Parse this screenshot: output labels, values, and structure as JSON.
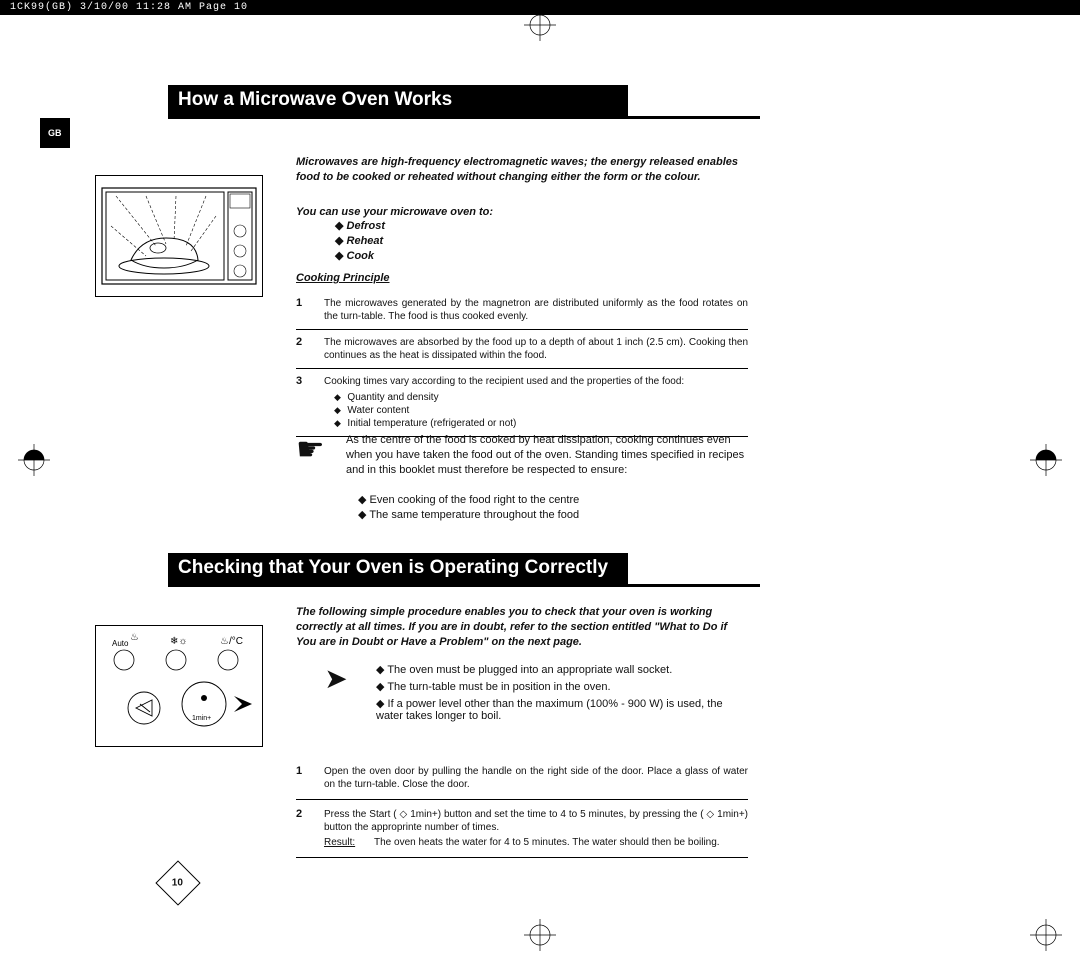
{
  "header": {
    "text": "1CK99(GB)  3/10/00 11:28 AM  Page 10"
  },
  "tab": "GB",
  "section1": {
    "title": "How a Microwave Oven Works",
    "intro": "Microwaves are high-frequency electromagnetic waves; the energy released enables food to be cooked or reheated without changing either the form or the colour.",
    "youcan": "You can use your microwave oven to:",
    "uses": {
      "a": "Defrost",
      "b": "Reheat",
      "c": "Cook"
    },
    "cooking_principle_title": "Cooking Principle",
    "steps": {
      "s1n": "1",
      "s1t": "The microwaves generated by the magnetron are distributed uniformly as the food rotates on the turn-table. The food is thus cooked evenly.",
      "s2n": "2",
      "s2t": "The microwaves are absorbed by the food up to a depth of about 1 inch (2.5 cm). Cooking then continues as the heat is dissipated within the food.",
      "s3n": "3",
      "s3t": "Cooking times vary according to the recipient used and the properties of the food:",
      "s3a": "Quantity and density",
      "s3b": "Water content",
      "s3c": "Initial temperature (refrigerated or not)"
    },
    "note": "As the centre of the food is cooked by heat dissipation, cooking continues even when you have taken the food out of the oven. Standing times specified in recipes and in this booklet must therefore be respected to ensure:",
    "tips": {
      "a": "Even cooking of the food right to the centre",
      "b": "The same temperature throughout the food"
    }
  },
  "section2": {
    "title": "Checking that Your Oven is Operating Correctly",
    "intro": "The following simple procedure enables you to check that your oven is working correctly at all times. If you are in doubt, refer to the section entitled \"What to Do if You are in Doubt or Have a Problem\" on the next page.",
    "arrows": {
      "a": "The oven must be plugged into an appropriate wall socket.",
      "b": "The turn-table must be in position in the oven.",
      "c": "If a power level other than the maximum (100% - 900 W) is used, the water takes longer to boil."
    },
    "steps": {
      "s1n": "1",
      "s1t": "Open the oven door by pulling the handle on the right side of the door. Place a glass of water on the turn-table. Close the door.",
      "s2n": "2",
      "s2t": "Press the Start ( ◇ 1min+) button and set the time to 4 to 5 minutes, by pressing the ( ◇ 1min+) button the approprinte number of times.",
      "result_label": "Result:",
      "result_text": "The oven heats the water for 4 to 5 minutes. The water should then be boiling."
    },
    "panel_labels": {
      "auto": "Auto",
      "onemin": "1min+"
    }
  },
  "page_number": "10"
}
